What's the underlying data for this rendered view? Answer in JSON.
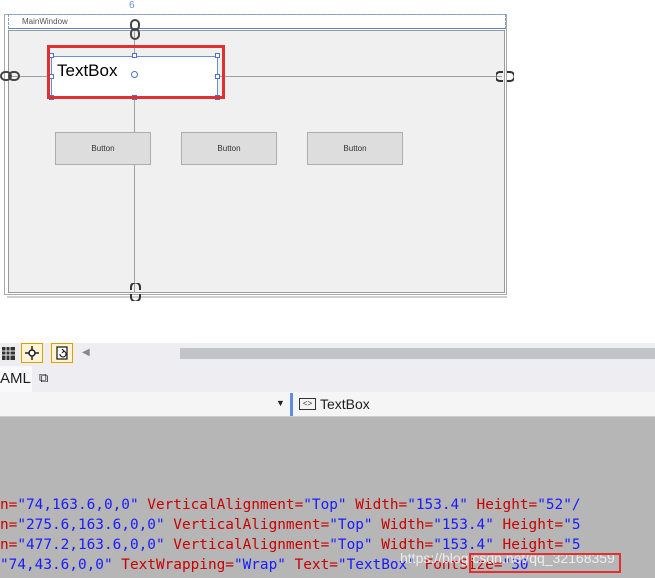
{
  "designer": {
    "top_number": "6",
    "window_title": "MainWindow",
    "textbox_text": "TextBox",
    "buttons": [
      {
        "label": "Button"
      },
      {
        "label": "Button"
      },
      {
        "label": "Button"
      }
    ]
  },
  "toolbar": {
    "tools": [
      "grid-icon",
      "snap-icon",
      "refresh-icon"
    ]
  },
  "tabs": {
    "xaml_label": "AML"
  },
  "navbar": {
    "right_icon_text": "<>",
    "right_label": "TextBox"
  },
  "code": {
    "lines": [
      {
        "prefix": "n=",
        "v1": "\"74,163.6,0,0\"",
        "a2": " VerticalAlignment=",
        "v2": "\"Top\"",
        "a3": " Width=",
        "v3": "\"153.4\"",
        "a4": " Height=",
        "v4": "\"52\"/"
      },
      {
        "prefix": "n=",
        "v1": "\"275.6,163.6,0,0\"",
        "a2": " VerticalAlignment=",
        "v2": "\"Top\"",
        "a3": " Width=",
        "v3": "\"153.4\"",
        "a4": " Height=",
        "v4": "\"5"
      },
      {
        "prefix": "n=",
        "v1": "\"477.2,163.6,0,0\"",
        "a2": " VerticalAlignment=",
        "v2": "\"Top\"",
        "a3": " Width=",
        "v3": "\"153.4\"",
        "a4": " Height=",
        "v4": "\"5"
      },
      {
        "prefix": "",
        "v1": "\"74,43.6,0,0\"",
        "a2": " TextWrapping=",
        "v2": "\"Wrap\"",
        "a3": " Text=",
        "v3": "\"TextBox\"",
        "a4": " FontSize=",
        "v4": "\"30"
      }
    ],
    "watermark": "https://blog.csdn.net/qq_32168359"
  }
}
